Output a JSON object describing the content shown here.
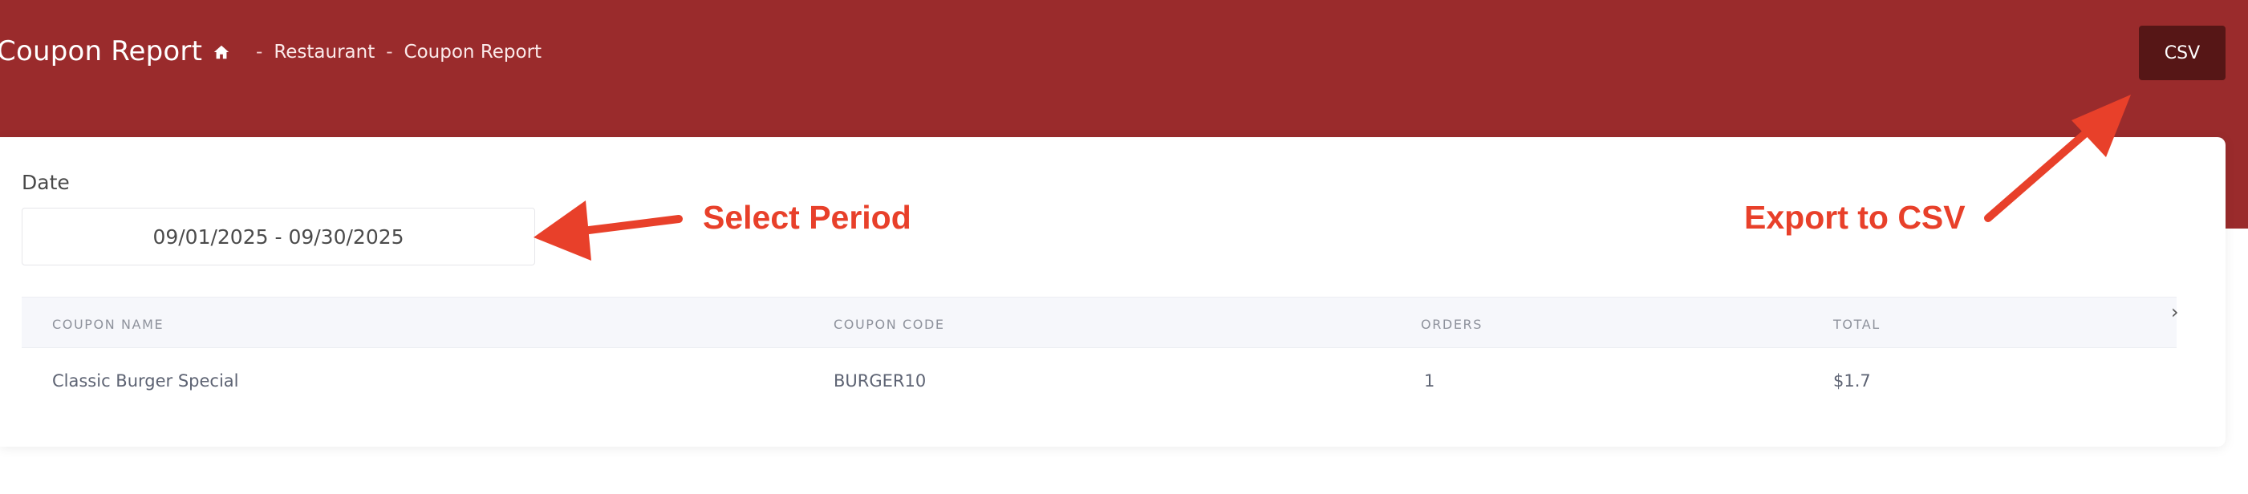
{
  "header": {
    "title": "Coupon Report",
    "breadcrumb": [
      "Restaurant",
      "Coupon Report"
    ],
    "home_icon": "home-icon",
    "csv_label": "CSV"
  },
  "filters": {
    "date_label": "Date",
    "date_value": "09/01/2025 - 09/30/2025"
  },
  "table": {
    "columns": [
      "COUPON NAME",
      "COUPON CODE",
      "ORDERS",
      "TOTAL"
    ],
    "rows": [
      [
        "Classic Burger Special",
        "BURGER10",
        "1",
        "$1.7"
      ]
    ]
  },
  "annotations": {
    "select_period": "Select Period",
    "export_csv": "Export to CSV"
  },
  "colors": {
    "header_bg": "#9a2b2c",
    "csv_button_bg": "#561616",
    "annotation": "#e8402a"
  }
}
